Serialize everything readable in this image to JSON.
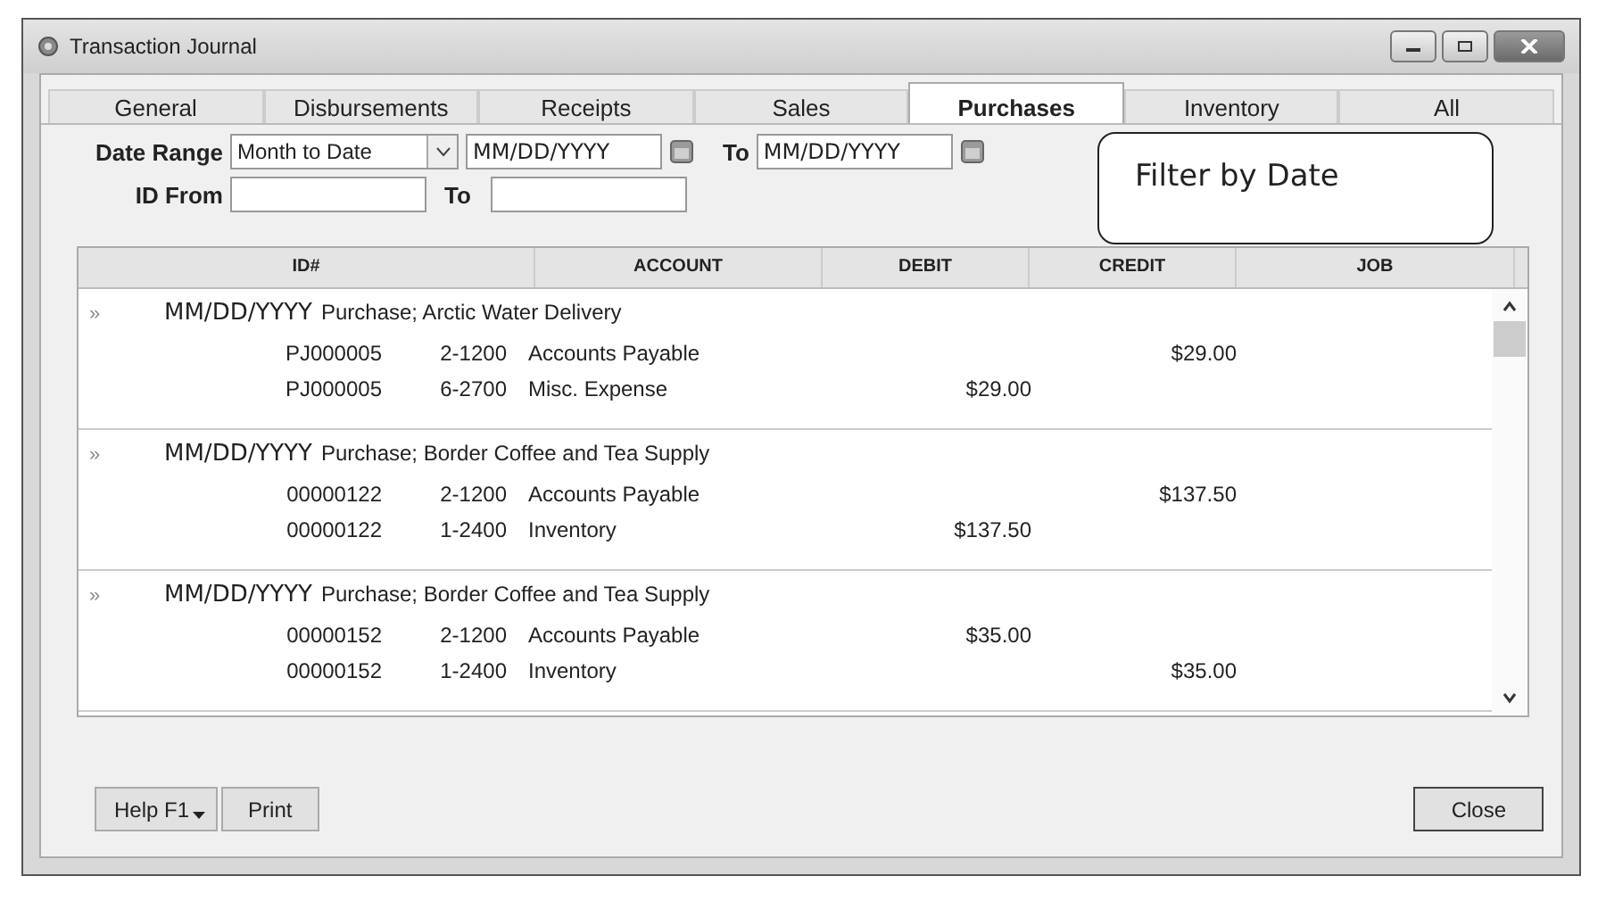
{
  "window": {
    "title": "Transaction Journal"
  },
  "tabs": [
    {
      "label": "General",
      "selected": false
    },
    {
      "label": "Disbursements",
      "selected": false
    },
    {
      "label": "Receipts",
      "selected": false
    },
    {
      "label": "Sales",
      "selected": false
    },
    {
      "label": "Purchases",
      "selected": true
    },
    {
      "label": "Inventory",
      "selected": false
    },
    {
      "label": "All",
      "selected": false
    }
  ],
  "filters": {
    "date_range_label": "Date Range",
    "date_range_value": "Month to Date",
    "date_from": "MM/DD/YYYY",
    "date_to_label": "To",
    "date_to": "MM/DD/YYYY",
    "id_from_label": "ID From",
    "id_to_label": "To"
  },
  "callout": "Filter by Date",
  "table": {
    "columns": [
      "ID#",
      "ACCOUNT",
      "DEBIT",
      "CREDIT",
      "JOB"
    ],
    "groups": [
      {
        "marker": "»",
        "date": "MM/DD/YYYY",
        "memo": "Purchase; Arctic Water Delivery",
        "lines": [
          {
            "id": "PJ000005",
            "account_no": "2-1200",
            "account": "Accounts Payable",
            "credit": "$29.00"
          },
          {
            "id": "PJ000005",
            "account_no": "6-2700",
            "account": "Misc. Expense",
            "debit": "$29.00"
          }
        ]
      },
      {
        "marker": "»",
        "date": "MM/DD/YYYY",
        "memo": "Purchase; Border Coffee and Tea Supply",
        "lines": [
          {
            "id": "00000122",
            "account_no": "2-1200",
            "account": "Accounts Payable",
            "credit": "$137.50"
          },
          {
            "id": "00000122",
            "account_no": "1-2400",
            "account": "Inventory",
            "debit": "$137.50"
          }
        ]
      },
      {
        "marker": "»",
        "date": "MM/DD/YYYY",
        "memo": "Purchase; Border Coffee and Tea Supply",
        "lines": [
          {
            "id": "00000152",
            "account_no": "2-1200",
            "account": "Accounts Payable",
            "debit": "$35.00"
          },
          {
            "id": "00000152",
            "account_no": "1-2400",
            "account": "Inventory",
            "credit": "$35.00"
          }
        ]
      }
    ]
  },
  "buttons": {
    "help": "Help F1",
    "print": "Print",
    "close": "Close"
  }
}
